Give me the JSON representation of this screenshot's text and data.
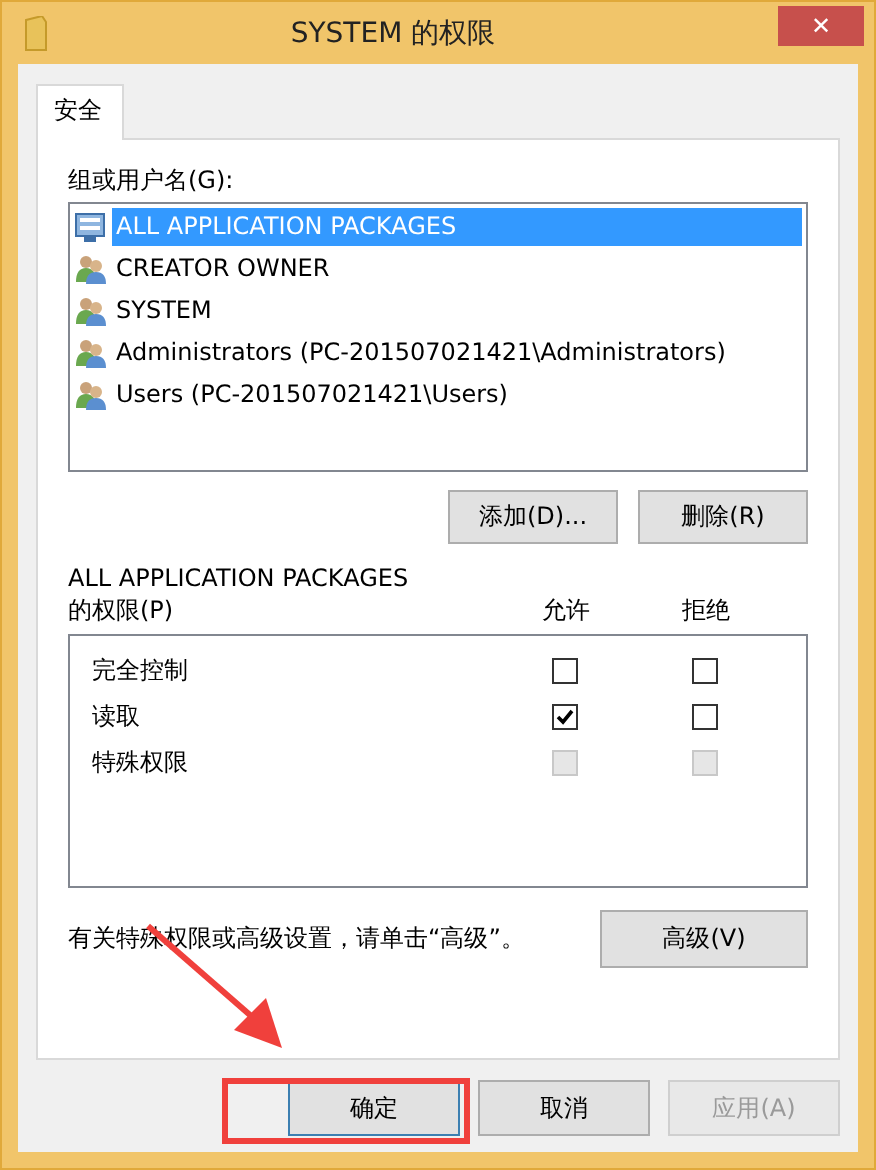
{
  "window": {
    "title": "SYSTEM 的权限",
    "close": "✕"
  },
  "tabs": [
    {
      "label": "安全",
      "selected": true
    }
  ],
  "groups": {
    "label": "组或用户名(G):",
    "items": [
      {
        "name": "ALL APPLICATION PACKAGES",
        "kind": "package",
        "selected": true
      },
      {
        "name": "CREATOR OWNER",
        "kind": "group",
        "selected": false
      },
      {
        "name": "SYSTEM",
        "kind": "group",
        "selected": false
      },
      {
        "name": "Administrators (PC-201507021421\\Administrators)",
        "kind": "group",
        "selected": false
      },
      {
        "name": "Users (PC-201507021421\\Users)",
        "kind": "group",
        "selected": false
      }
    ],
    "buttons": [
      {
        "label": "添加(D)...",
        "disabled": false
      },
      {
        "label": "删除(R)",
        "disabled": false
      }
    ]
  },
  "permissions": {
    "label_line1": "ALL APPLICATION PACKAGES",
    "label_line2": "的权限(P)",
    "columns": [
      "允许",
      "拒绝"
    ],
    "rows": [
      {
        "name": "完全控制",
        "allow": {
          "checked": false,
          "disabled": false
        },
        "deny": {
          "checked": false,
          "disabled": false
        }
      },
      {
        "name": "读取",
        "allow": {
          "checked": true,
          "disabled": false
        },
        "deny": {
          "checked": false,
          "disabled": false
        }
      },
      {
        "name": "特殊权限",
        "allow": {
          "checked": false,
          "disabled": true
        },
        "deny": {
          "checked": false,
          "disabled": true
        }
      }
    ]
  },
  "advanced": {
    "note": "有关特殊权限或高级设置，请单击“高级”。",
    "button": "高级(V)"
  },
  "footer_buttons": [
    {
      "label": "确定",
      "default": true,
      "disabled": false
    },
    {
      "label": "取消",
      "default": false,
      "disabled": false
    },
    {
      "label": "应用(A)",
      "default": false,
      "disabled": true
    }
  ],
  "annotation": {
    "arrow": true,
    "highlight_box": true
  }
}
